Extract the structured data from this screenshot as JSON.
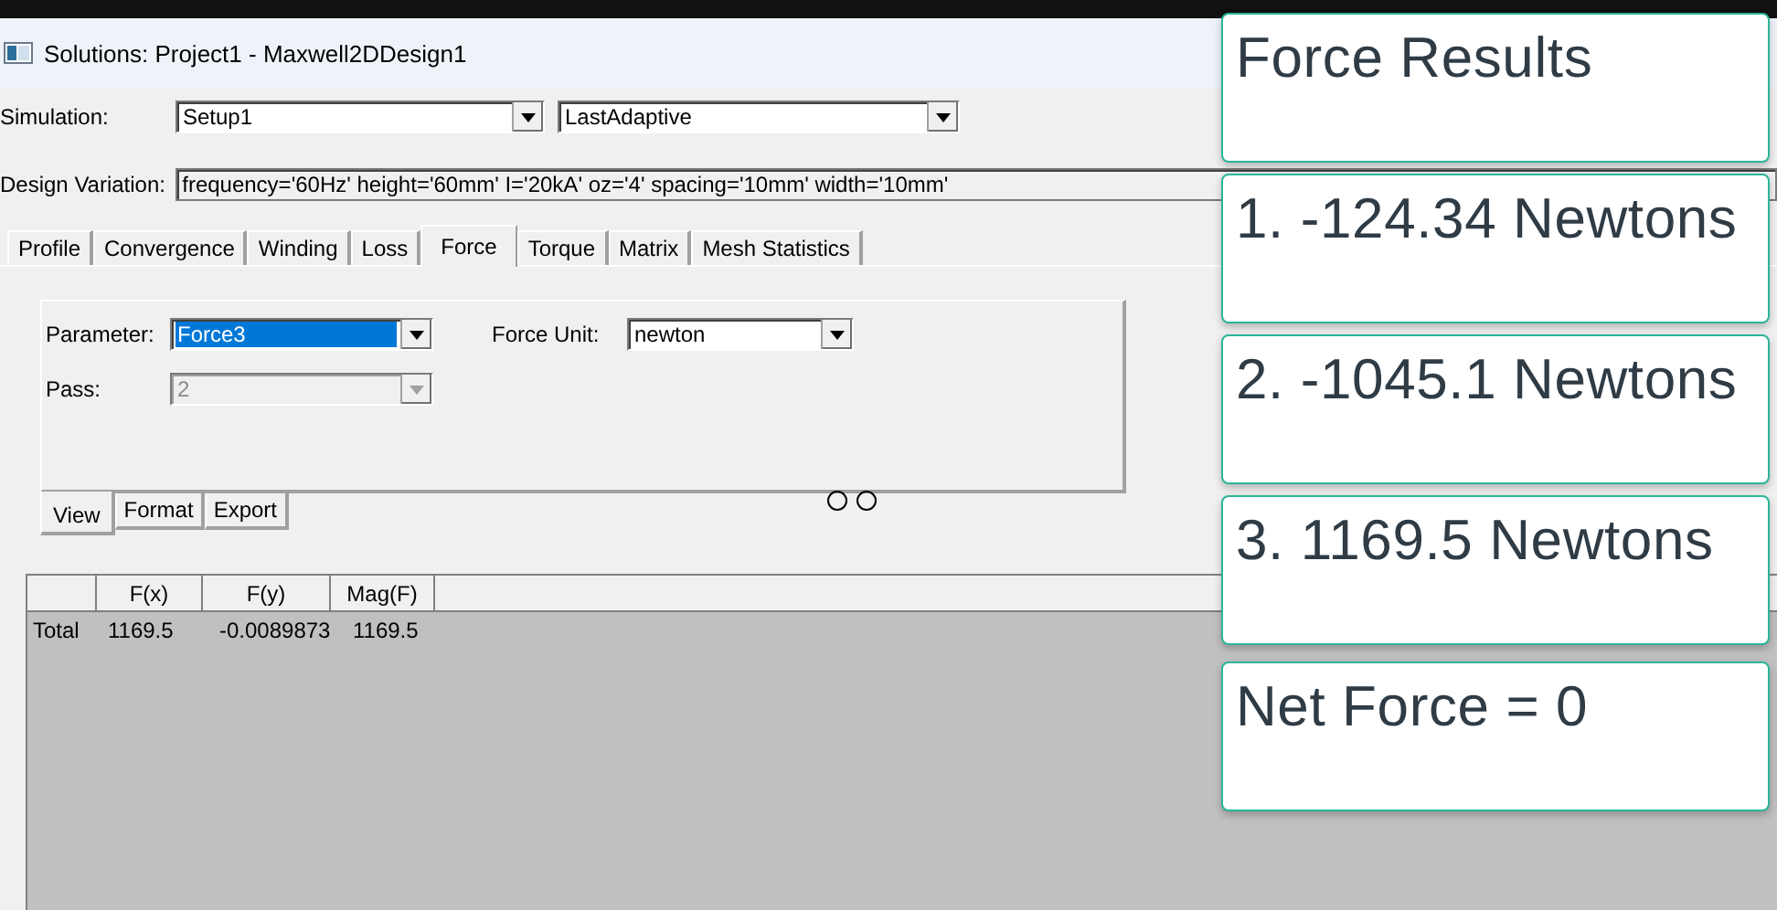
{
  "window": {
    "title": "Solutions: Project1 - Maxwell2DDesign1"
  },
  "simulation": {
    "label": "Simulation:",
    "setup": {
      "value": "Setup1"
    },
    "solution": {
      "value": "LastAdaptive"
    }
  },
  "design_variation": {
    "label": "Design Variation:",
    "value": "frequency='60Hz' height='60mm' I='20kA' oz='4' spacing='10mm' width='10mm'"
  },
  "tabs": [
    {
      "label": "Profile",
      "selected": false
    },
    {
      "label": "Convergence",
      "selected": false
    },
    {
      "label": "Winding",
      "selected": false
    },
    {
      "label": "Loss",
      "selected": false
    },
    {
      "label": "Force",
      "selected": true
    },
    {
      "label": "Torque",
      "selected": false
    },
    {
      "label": "Matrix",
      "selected": false
    },
    {
      "label": "Mesh Statistics",
      "selected": false
    }
  ],
  "force_panel": {
    "fields": [
      {
        "label": "Parameter:",
        "value": "Force3",
        "highlighted": true,
        "disabled": false
      },
      {
        "label": "Force Unit:",
        "value": "newton",
        "highlighted": false,
        "disabled": false
      },
      {
        "label": "Pass:",
        "value": "2",
        "highlighted": false,
        "disabled": true
      }
    ]
  },
  "subtabs": [
    {
      "label": "View",
      "selected": true
    },
    {
      "label": "Format",
      "selected": false
    },
    {
      "label": "Export",
      "selected": false
    }
  ],
  "table": {
    "columns": [
      "F(x)",
      "F(y)",
      "Mag(F)"
    ],
    "rows": [
      {
        "name": "Total",
        "cells": [
          "1169.5",
          "-0.0089873",
          "1169.5"
        ]
      }
    ]
  },
  "overlay_cards": [
    "Force Results",
    "1. -124.34 Newtons",
    "2. -1045.1 Newtons",
    "3. 1169.5 Newtons",
    "Net Force = 0"
  ]
}
